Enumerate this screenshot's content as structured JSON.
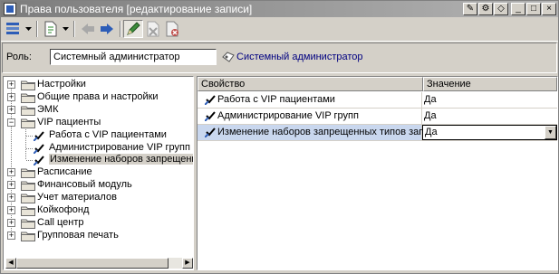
{
  "window": {
    "title": "Права пользователя [редактирование записи]"
  },
  "toolbar": {
    "buttons": [
      "menu-icon",
      "dropdown-icon",
      "document-icon",
      "back-arrow-icon",
      "forward-arrow-icon",
      "pencil-icon",
      "delete-icon",
      "cancel-icon"
    ]
  },
  "role": {
    "label": "Роль:",
    "value": "Системный администратор",
    "link": "Системный администратор"
  },
  "tree": {
    "items": [
      {
        "label": "Настройки",
        "expander": "+"
      },
      {
        "label": "Общие права и настройки",
        "expander": "+"
      },
      {
        "label": "ЭМК",
        "expander": "+"
      },
      {
        "label": "VIP пациенты",
        "expander": "−"
      },
      {
        "label": "Работа с VIP пациентами"
      },
      {
        "label": "Администрирование VIP групп"
      },
      {
        "label": "Изменение наборов запрещенных"
      },
      {
        "label": "Расписание",
        "expander": "+"
      },
      {
        "label": "Финансовый модуль",
        "expander": "+"
      },
      {
        "label": "Учет материалов",
        "expander": "+"
      },
      {
        "label": "Койкофонд",
        "expander": "+"
      },
      {
        "label": "Call центр",
        "expander": "+"
      },
      {
        "label": "Групповая печать",
        "expander": "+"
      }
    ]
  },
  "grid": {
    "columns": [
      "Свойство",
      "Значение"
    ],
    "rows": [
      {
        "property": "Работа с VIP пациентами",
        "value": "Да"
      },
      {
        "property": "Администрирование VIP групп",
        "value": "Да"
      },
      {
        "property": "Изменение наборов запрещенных типов записей",
        "value": "Да"
      }
    ]
  },
  "colors": {
    "titlebar": "#7c7c7c",
    "selection": "#c9d7ee",
    "link": "#000080",
    "face": "#d4d0c8"
  }
}
